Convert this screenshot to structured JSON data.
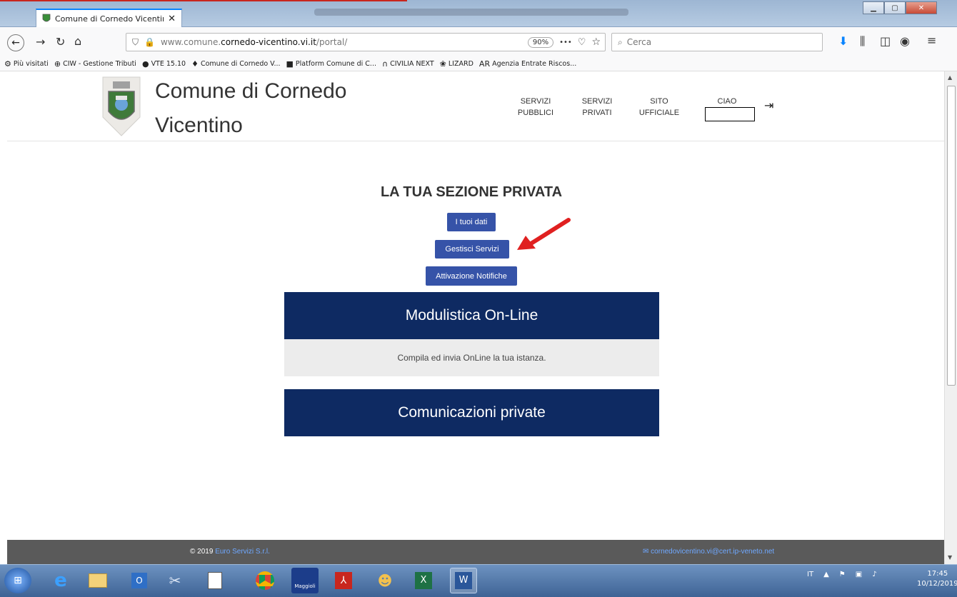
{
  "browser": {
    "tab_title": "Comune di Cornedo Vicentino",
    "url_prefix": "www.comune.",
    "url_domain": "cornedo-vicentino.vi.it",
    "url_path": "/portal/",
    "zoom": "90%",
    "search_placeholder": "Cerca",
    "more_glyph": "•••",
    "bookmarks": [
      {
        "label": "Più visitati",
        "icon": "gear-icon",
        "glyph": "⚙"
      },
      {
        "label": "CIW - Gestione Tributi",
        "icon": "globe-icon",
        "glyph": "⊕"
      },
      {
        "label": "VTE 15.10",
        "icon": "vte-icon",
        "glyph": "●"
      },
      {
        "label": "Comune di Cornedo V...",
        "icon": "crest-icon",
        "glyph": "♦"
      },
      {
        "label": "Platform Comune di C...",
        "icon": "platform-icon",
        "glyph": "■"
      },
      {
        "label": "CIVILIA NEXT",
        "icon": "civilia-icon",
        "glyph": "∩"
      },
      {
        "label": "LIZARD",
        "icon": "lizard-icon",
        "glyph": "❀"
      },
      {
        "label": "Agenzia Entrate Riscos...",
        "icon": "ader-icon",
        "glyph": "AR"
      }
    ]
  },
  "site": {
    "title_line1": "Comune di Cornedo",
    "title_line2": "Vicentino",
    "menu": [
      {
        "line1": "SERVIZI",
        "line2": "PUBBLICI"
      },
      {
        "line1": "SERVIZI",
        "line2": "PRIVATI"
      },
      {
        "line1": "SITO",
        "line2": "UFFICIALE"
      },
      {
        "line1": "CIAO",
        "line2": ""
      }
    ]
  },
  "main": {
    "section_title": "LA TUA SEZIONE PRIVATA",
    "buttons": {
      "dati": "I tuoi dati",
      "servizi": "Gestisci Servizi",
      "notifiche": "Attivazione Notifiche"
    },
    "panels": [
      {
        "title": "Modulistica On-Line",
        "body": "Compila ed invia OnLine la tua istanza."
      },
      {
        "title": "Comunicazioni private",
        "body": ""
      }
    ]
  },
  "footer": {
    "copyright": "© 2019",
    "company": "Euro Servizi S.r.l.",
    "email": "cornedovicentino.vi@cert.ip-veneto.net"
  },
  "taskbar": {
    "language": "IT",
    "time": "17:45",
    "date": "10/12/2019",
    "app_label_maggioli": "Maggioli"
  },
  "colors": {
    "panel_navy": "#0e2a62",
    "button_blue": "#3653a8",
    "arrow_red": "#e02020",
    "footer_gray": "#5a5a5a"
  }
}
